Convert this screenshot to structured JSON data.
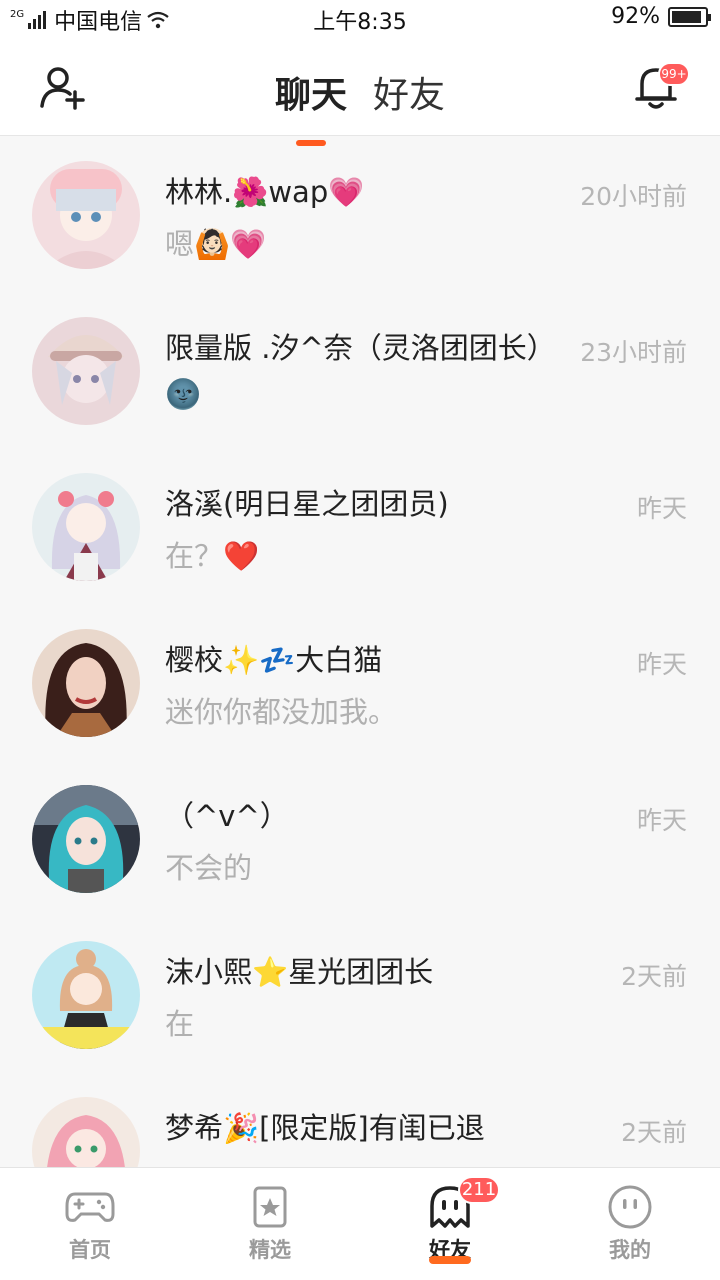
{
  "status_bar": {
    "network_type": "2G",
    "carrier": "中国电信",
    "time": "上午8:35",
    "battery": "92%",
    "battery_level": 0.92
  },
  "header": {
    "tabs": [
      {
        "label": "聊天",
        "active": true
      },
      {
        "label": "好友",
        "active": false
      }
    ],
    "notification_badge": "99+",
    "accent_color": "#ff5a1f"
  },
  "chats": [
    {
      "name": "林林.🌺wap💗",
      "time": "20小时前",
      "message": "嗯🙆🏻💗"
    },
    {
      "name": "限量版 .汐^奈（灵洛团团长）",
      "time": "23小时前",
      "message": "🌚"
    },
    {
      "name": "洛溪(明日星之团团员)",
      "time": "昨天",
      "message": "在？❤️"
    },
    {
      "name": "樱校✨💤大白猫",
      "time": "昨天",
      "message": "迷你你都没加我。"
    },
    {
      "name": "（^v^）",
      "time": "昨天",
      "message": "不会的"
    },
    {
      "name": "沫小熙⭐星光团团长",
      "time": "2天前",
      "message": "在"
    },
    {
      "name": "梦希🎉[限定版]有闺已退",
      "time": "2天前",
      "message": ""
    }
  ],
  "bottom_nav": {
    "items": [
      {
        "label": "首页",
        "icon": "gamepad-icon",
        "active": false
      },
      {
        "label": "精选",
        "icon": "star-card-icon",
        "active": false
      },
      {
        "label": "好友",
        "icon": "ghost-icon",
        "active": true
      },
      {
        "label": "我的",
        "icon": "face-icon",
        "active": false
      }
    ],
    "friends_badge": "211"
  }
}
